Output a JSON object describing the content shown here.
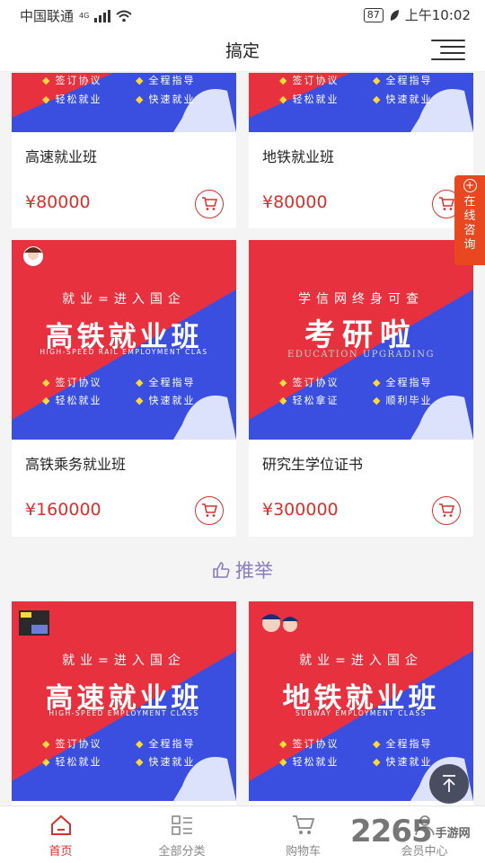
{
  "status_bar": {
    "carrier": "中国联通",
    "network": "4G",
    "battery": "87",
    "time": "上午10:02"
  },
  "header": {
    "title": "搞定"
  },
  "products_top": [
    {
      "name": "高速就业班",
      "price": "¥80000",
      "banner": {
        "row1a": "签订协议",
        "row1b": "全程指导",
        "row2a": "轻松就业",
        "row2b": "快速就业"
      }
    },
    {
      "name": "地铁就业班",
      "price": "¥80000",
      "banner": {
        "row1a": "签订协议",
        "row1b": "全程指导",
        "row2a": "轻松就业",
        "row2b": "快速就业"
      }
    },
    {
      "name": "高铁乘务就业班",
      "price": "¥160000",
      "banner": {
        "sub": "就业=进入国企",
        "main": "高铁就业班",
        "en": "HIGH-SPEED RAIL EMPLOYMENT CLAS",
        "row1a": "签订协议",
        "row1b": "全程指导",
        "row2a": "轻松就业",
        "row2b": "快速就业"
      }
    },
    {
      "name": "研究生学位证书",
      "price": "¥300000",
      "banner": {
        "sub": "学信网终身可查",
        "main": "考研啦",
        "en": "EDUCATION UPGRADING",
        "row1a": "签订协议",
        "row1b": "全程指导",
        "row2a": "轻松拿证",
        "row2b": "顺利毕业"
      }
    }
  ],
  "recommend": {
    "title": "推举",
    "items": [
      {
        "banner": {
          "sub": "就业=进入国企",
          "main": "高速就业班",
          "en": "HIGH-SPEED EMPLOYMENT CLASS",
          "row1a": "签订协议",
          "row1b": "全程指导",
          "row2a": "轻松就业",
          "row2b": "快速就业"
        }
      },
      {
        "banner": {
          "sub": "就业=进入国企",
          "main": "地铁就业班",
          "en": "SUBWAY EMPLOYMENT CLASS",
          "row1a": "签订协议",
          "row1b": "全程指导",
          "row2a": "轻松就业",
          "row2b": "快速就业"
        }
      }
    ]
  },
  "consult": {
    "label": "在线咨询"
  },
  "tabbar": [
    {
      "label": "首页",
      "icon": "home-icon",
      "active": true
    },
    {
      "label": "全部分类",
      "icon": "category-icon",
      "active": false
    },
    {
      "label": "购物车",
      "icon": "cart-icon",
      "active": false
    },
    {
      "label": "会员中心",
      "icon": "user-icon",
      "active": false
    }
  ],
  "watermark": {
    "brand": "2265",
    "site": "手游网"
  },
  "colors": {
    "accent": "#d9302c",
    "banner_red": "#e8313f",
    "banner_blue": "#3a4fe0",
    "section_title": "#8a7dbb"
  }
}
